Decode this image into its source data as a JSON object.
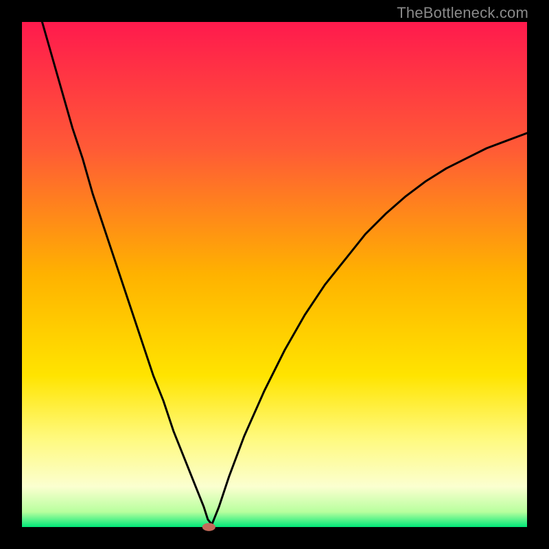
{
  "watermark": "TheBottleneck.com",
  "chart_data": {
    "type": "line",
    "title": "",
    "xlabel": "",
    "ylabel": "",
    "xlim": [
      0,
      100
    ],
    "ylim": [
      0,
      100
    ],
    "gradient_stops": [
      {
        "offset": 0.0,
        "color": "#ff1a4d"
      },
      {
        "offset": 0.25,
        "color": "#ff5a36"
      },
      {
        "offset": 0.5,
        "color": "#ffb200"
      },
      {
        "offset": 0.7,
        "color": "#ffe400"
      },
      {
        "offset": 0.82,
        "color": "#fff97a"
      },
      {
        "offset": 0.92,
        "color": "#fbffd0"
      },
      {
        "offset": 0.97,
        "color": "#b8ff9e"
      },
      {
        "offset": 1.0,
        "color": "#00e878"
      }
    ],
    "minimum_marker": {
      "x": 37,
      "y": 0,
      "color": "#c46a5a",
      "rx": 1.3,
      "ry": 0.8
    },
    "series": [
      {
        "name": "bottleneck-curve",
        "x": [
          4,
          6,
          8,
          10,
          12,
          14,
          16,
          18,
          20,
          22,
          24,
          26,
          28,
          30,
          32,
          34,
          36,
          36.8,
          37.6,
          39,
          41,
          44,
          48,
          52,
          56,
          60,
          64,
          68,
          72,
          76,
          80,
          84,
          88,
          92,
          96,
          100
        ],
        "y": [
          100,
          93,
          86,
          79,
          73,
          66,
          60,
          54,
          48,
          42,
          36,
          30,
          25,
          19,
          14,
          9,
          4,
          1.5,
          0.5,
          4,
          10,
          18,
          27,
          35,
          42,
          48,
          53,
          58,
          62,
          65.5,
          68.5,
          71,
          73,
          75,
          76.5,
          78
        ]
      }
    ]
  }
}
